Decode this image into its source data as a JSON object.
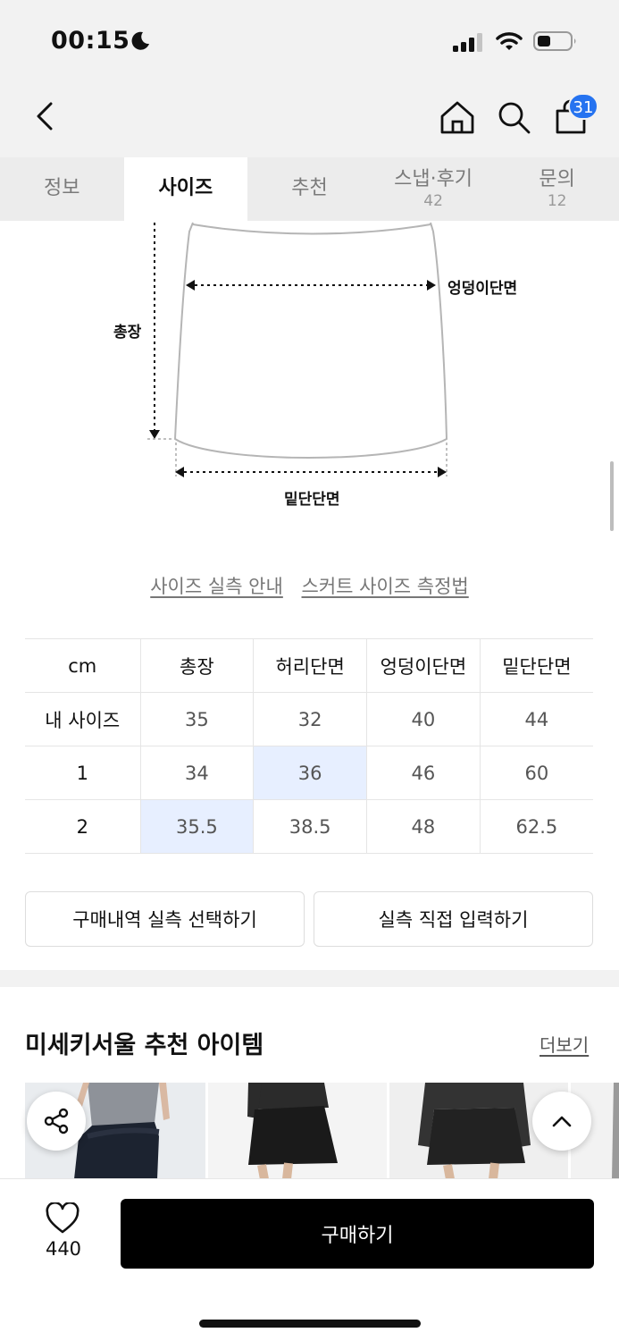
{
  "status_bar": {
    "time": "00:15"
  },
  "header": {
    "cart_count": "31"
  },
  "tabs": [
    {
      "label": "정보",
      "count": ""
    },
    {
      "label": "사이즈",
      "count": ""
    },
    {
      "label": "추천",
      "count": ""
    },
    {
      "label": "스냅·후기",
      "count": "42"
    },
    {
      "label": "문의",
      "count": "12"
    }
  ],
  "diagram": {
    "length_label": "총장",
    "hip_label": "엉덩이단면",
    "hem_label": "밑단단면"
  },
  "guide_links": [
    "사이즈 실측 안내",
    "스커트 사이즈 측정법"
  ],
  "size_table": {
    "headers": [
      "cm",
      "총장",
      "허리단면",
      "엉덩이단면",
      "밑단단면"
    ],
    "rows": [
      [
        "내 사이즈",
        "35",
        "32",
        "40",
        "44"
      ],
      [
        "1",
        "34",
        "36",
        "46",
        "60"
      ],
      [
        "2",
        "35.5",
        "38.5",
        "48",
        "62.5"
      ]
    ]
  },
  "actions": {
    "purchase_history_label": "구매내역 실측 선택하기",
    "manual_input_label": "실측 직접 입력하기"
  },
  "recommend": {
    "title": "미세키서울 추천 아이템",
    "more_label": "더보기"
  },
  "bottom_bar": {
    "like_count": "440",
    "buy_label": "구매하기"
  },
  "colors": {
    "accent": "#2673f0",
    "highlight": "#e7efff",
    "buy_button": "#000000"
  }
}
